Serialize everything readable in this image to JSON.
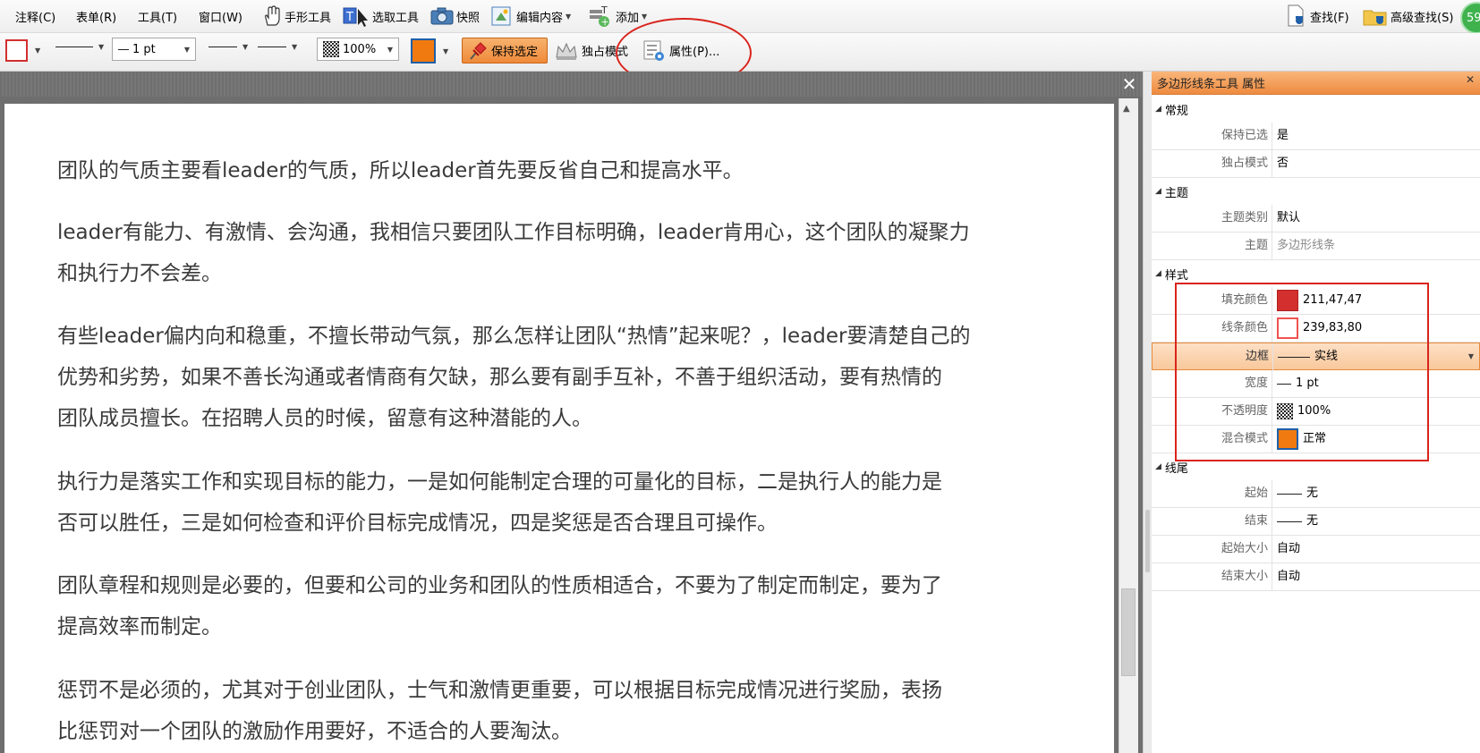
{
  "menubar": {
    "items": [
      "注释(C)",
      "表单(R)",
      "工具(T)",
      "窗口(W)"
    ],
    "hand_tool": "手形工具",
    "select_tool": "选取工具",
    "snapshot": "快照",
    "edit_content": "编辑内容",
    "add": "添加",
    "find": "查找(F)",
    "advanced_find": "高级查找(S)",
    "avatar_badge": "59"
  },
  "toolbar": {
    "line_width": "1 pt",
    "opacity": "100%",
    "keep_selected": "保持选定",
    "exclusive_mode": "独占模式",
    "properties": "属性(P)...",
    "border_color": "#d32f2f",
    "fill_accent": "#f07a10"
  },
  "document": {
    "paragraphs": [
      [
        "团队的气质主要看leader的气质，所以leader首先要反省自己和提高水平。"
      ],
      [
        "leader有能力、有激情、会沟通，我相信只要团队工作目标明确，leader肯用心，这个团队的凝聚力",
        "和执行力不会差。"
      ],
      [
        "有些leader偏内向和稳重，不擅长带动气氛，那么怎样让团队“热情”起来呢？，leader要清楚自己的",
        "优势和劣势，如果不善长沟通或者情商有欠缺，那么要有副手互补，不善于组织活动，要有热情的",
        "团队成员擅长。在招聘人员的时候，留意有这种潜能的人。"
      ],
      [
        "执行力是落实工作和实现目标的能力，一是如何能制定合理的可量化的目标，二是执行人的能力是",
        "否可以胜任，三是如何检查和评价目标完成情况，四是奖惩是否合理且可操作。"
      ],
      [
        "团队章程和规则是必要的，但要和公司的业务和团队的性质相适合，不要为了制定而制定，要为了",
        "提高效率而制定。"
      ],
      [
        "惩罚不是必须的，尤其对于创业团队，士气和激情更重要，可以根据目标完成情况进行奖励，表扬",
        "比惩罚对一个团队的激励作用要好，不适合的人要淘汰。"
      ]
    ]
  },
  "props": {
    "title": "多边形线条工具 属性",
    "sections": {
      "general": "常规",
      "theme": "主题",
      "style": "样式",
      "line_end": "线尾"
    },
    "rows": {
      "keep_selected": {
        "label": "保持已选",
        "value": "是"
      },
      "exclusive": {
        "label": "独占模式",
        "value": "否"
      },
      "theme_category": {
        "label": "主题类别",
        "value": "默认"
      },
      "theme": {
        "label": "主题",
        "value": "多边形线条"
      },
      "fill_color": {
        "label": "填充颜色",
        "value": "211,47,47",
        "swatch": "#d32f2f"
      },
      "line_color": {
        "label": "线条颜色",
        "value": "239,83,80",
        "swatch": "#ef5350"
      },
      "border": {
        "label": "边框",
        "value": "实线"
      },
      "width": {
        "label": "宽度",
        "value": "1 pt"
      },
      "opacity": {
        "label": "不透明度",
        "value": "100%"
      },
      "blend": {
        "label": "混合模式",
        "value": "正常"
      },
      "start": {
        "label": "起始",
        "value": "无"
      },
      "end": {
        "label": "结束",
        "value": "无"
      },
      "start_size": {
        "label": "起始大小",
        "value": "自动"
      },
      "end_size": {
        "label": "结束大小",
        "value": "自动"
      }
    }
  }
}
